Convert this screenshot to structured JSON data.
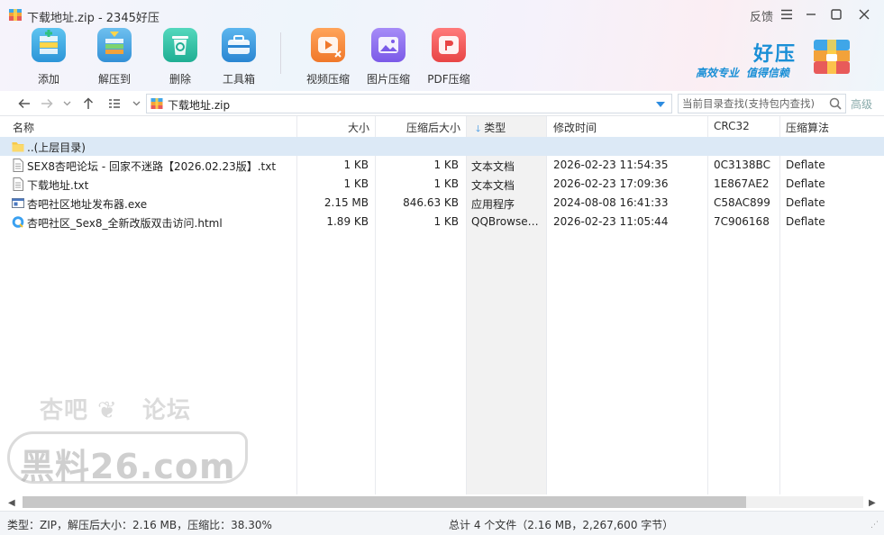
{
  "window": {
    "title": "下载地址.zip - 2345好压",
    "feedback": "反馈",
    "controls": [
      "menu-icon",
      "minimize-icon",
      "maximize-icon",
      "close-icon"
    ]
  },
  "toolbar": {
    "tools": [
      {
        "label": "添加",
        "icon": "add-archive-icon",
        "color": "#3fb5e8"
      },
      {
        "label": "解压到",
        "icon": "extract-icon",
        "color": "#4aa8e0"
      },
      {
        "label": "删除",
        "icon": "recycle-bin-icon",
        "color": "#2ec6a9"
      },
      {
        "label": "工具箱",
        "icon": "toolbox-icon",
        "color": "#3a9ce0"
      },
      {
        "label": "视频压缩",
        "icon": "video-compress-icon",
        "color": "#f28b3a"
      },
      {
        "label": "图片压缩",
        "icon": "image-compress-icon",
        "color": "#8b6cf0"
      },
      {
        "label": "PDF压缩",
        "icon": "pdf-compress-icon",
        "color": "#f05a5a"
      }
    ]
  },
  "brand": {
    "name": "好压",
    "slogan_1": "高效专业",
    "slogan_2": "值得信赖",
    "color": "#1a8fd6"
  },
  "address": {
    "path": "下载地址.zip",
    "search_placeholder": "当前目录查找(支持包内查找)",
    "advanced": "高级"
  },
  "columns": {
    "name": "名称",
    "size": "大小",
    "packed": "压缩后大小",
    "type": "类型",
    "mtime": "修改时间",
    "crc": "CRC32",
    "method": "压缩算法"
  },
  "parent_row": "..(上层目录)",
  "files": [
    {
      "name": "SEX8杏吧论坛 - 回家不迷路【2026.02.23版】.txt",
      "size": "1 KB",
      "packed": "1 KB",
      "type": "文本文档",
      "mtime": "2026-02-23 11:54:35",
      "crc": "0C3138BC",
      "method": "Deflate",
      "icon": "text-file-icon"
    },
    {
      "name": "下载地址.txt",
      "size": "1 KB",
      "packed": "1 KB",
      "type": "文本文档",
      "mtime": "2026-02-23 17:09:36",
      "crc": "1E867AE2",
      "method": "Deflate",
      "icon": "text-file-icon"
    },
    {
      "name": "杏吧社区地址发布器.exe",
      "size": "2.15 MB",
      "packed": "846.63 KB",
      "type": "应用程序",
      "mtime": "2024-08-08 16:41:33",
      "crc": "C58AC899",
      "method": "Deflate",
      "icon": "exe-file-icon"
    },
    {
      "name": "杏吧社区_Sex8_全新改版双击访问.html",
      "size": "1.89 KB",
      "packed": "1 KB",
      "type": "QQBrowse…",
      "mtime": "2026-02-23 11:05:44",
      "crc": "7C906168",
      "method": "Deflate",
      "icon": "browser-html-icon"
    }
  ],
  "watermark": {
    "line1": "杏吧",
    "line2": "论坛",
    "big": "黑料26.com"
  },
  "status": {
    "left": "类型：ZIP，解压后大小：2.16 MB，压缩比：38.30%",
    "middle": "总计 4 个文件（2.16 MB，2,267,600 字节）"
  }
}
